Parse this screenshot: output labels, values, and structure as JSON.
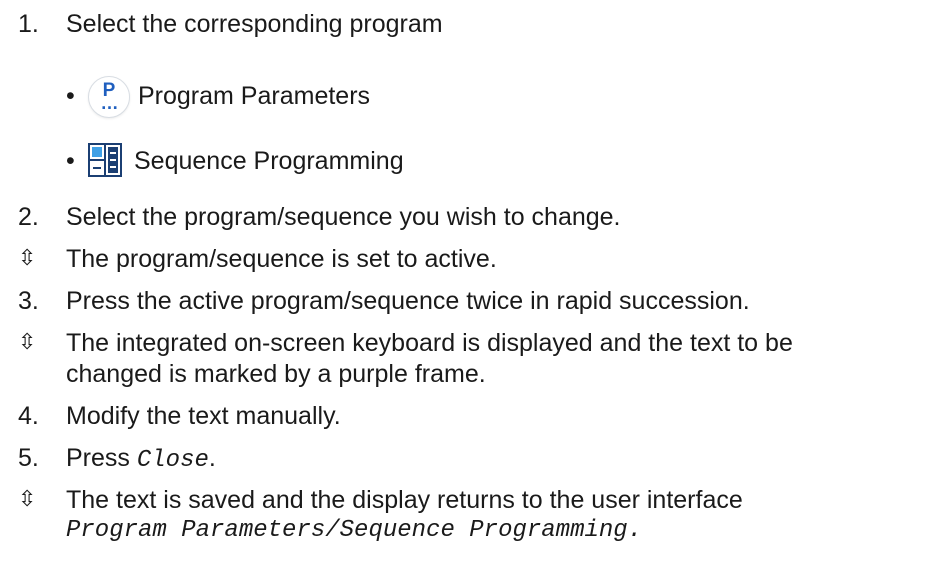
{
  "steps": {
    "s1": {
      "num": "1.",
      "text": "Select the corresponding program"
    },
    "sub1": {
      "bullet": "•",
      "icon": "program-parameters-icon",
      "text": "Program Parameters"
    },
    "sub2": {
      "bullet": "•",
      "icon": "sequence-programming-icon",
      "text": "Sequence Programming"
    },
    "s2": {
      "num": "2.",
      "text": "Select the program/sequence you wish to change."
    },
    "r2": {
      "marker": "⇳",
      "text": "The program/sequence is set to active."
    },
    "s3": {
      "num": "3.",
      "text": "Press the active program/sequence twice in rapid succession."
    },
    "r3": {
      "marker": "⇳",
      "line1": "The integrated on-screen keyboard is displayed and the text to be",
      "line2": "changed is marked by a purple frame."
    },
    "s4": {
      "num": "4.",
      "text": "Modify the text manually."
    },
    "s5": {
      "num": "5.",
      "text_before": "Press ",
      "code": "Close",
      "text_after": "."
    },
    "r5": {
      "marker": "⇳",
      "line1": "The text is saved and the display returns to the user interface",
      "line2": "Program Parameters/Sequence Programming."
    }
  },
  "icons": {
    "program_parameters": {
      "letter": "P",
      "dots": "…",
      "color": "#1f5fbf"
    },
    "sequence_programming": {
      "color": "#1b3f73"
    }
  }
}
